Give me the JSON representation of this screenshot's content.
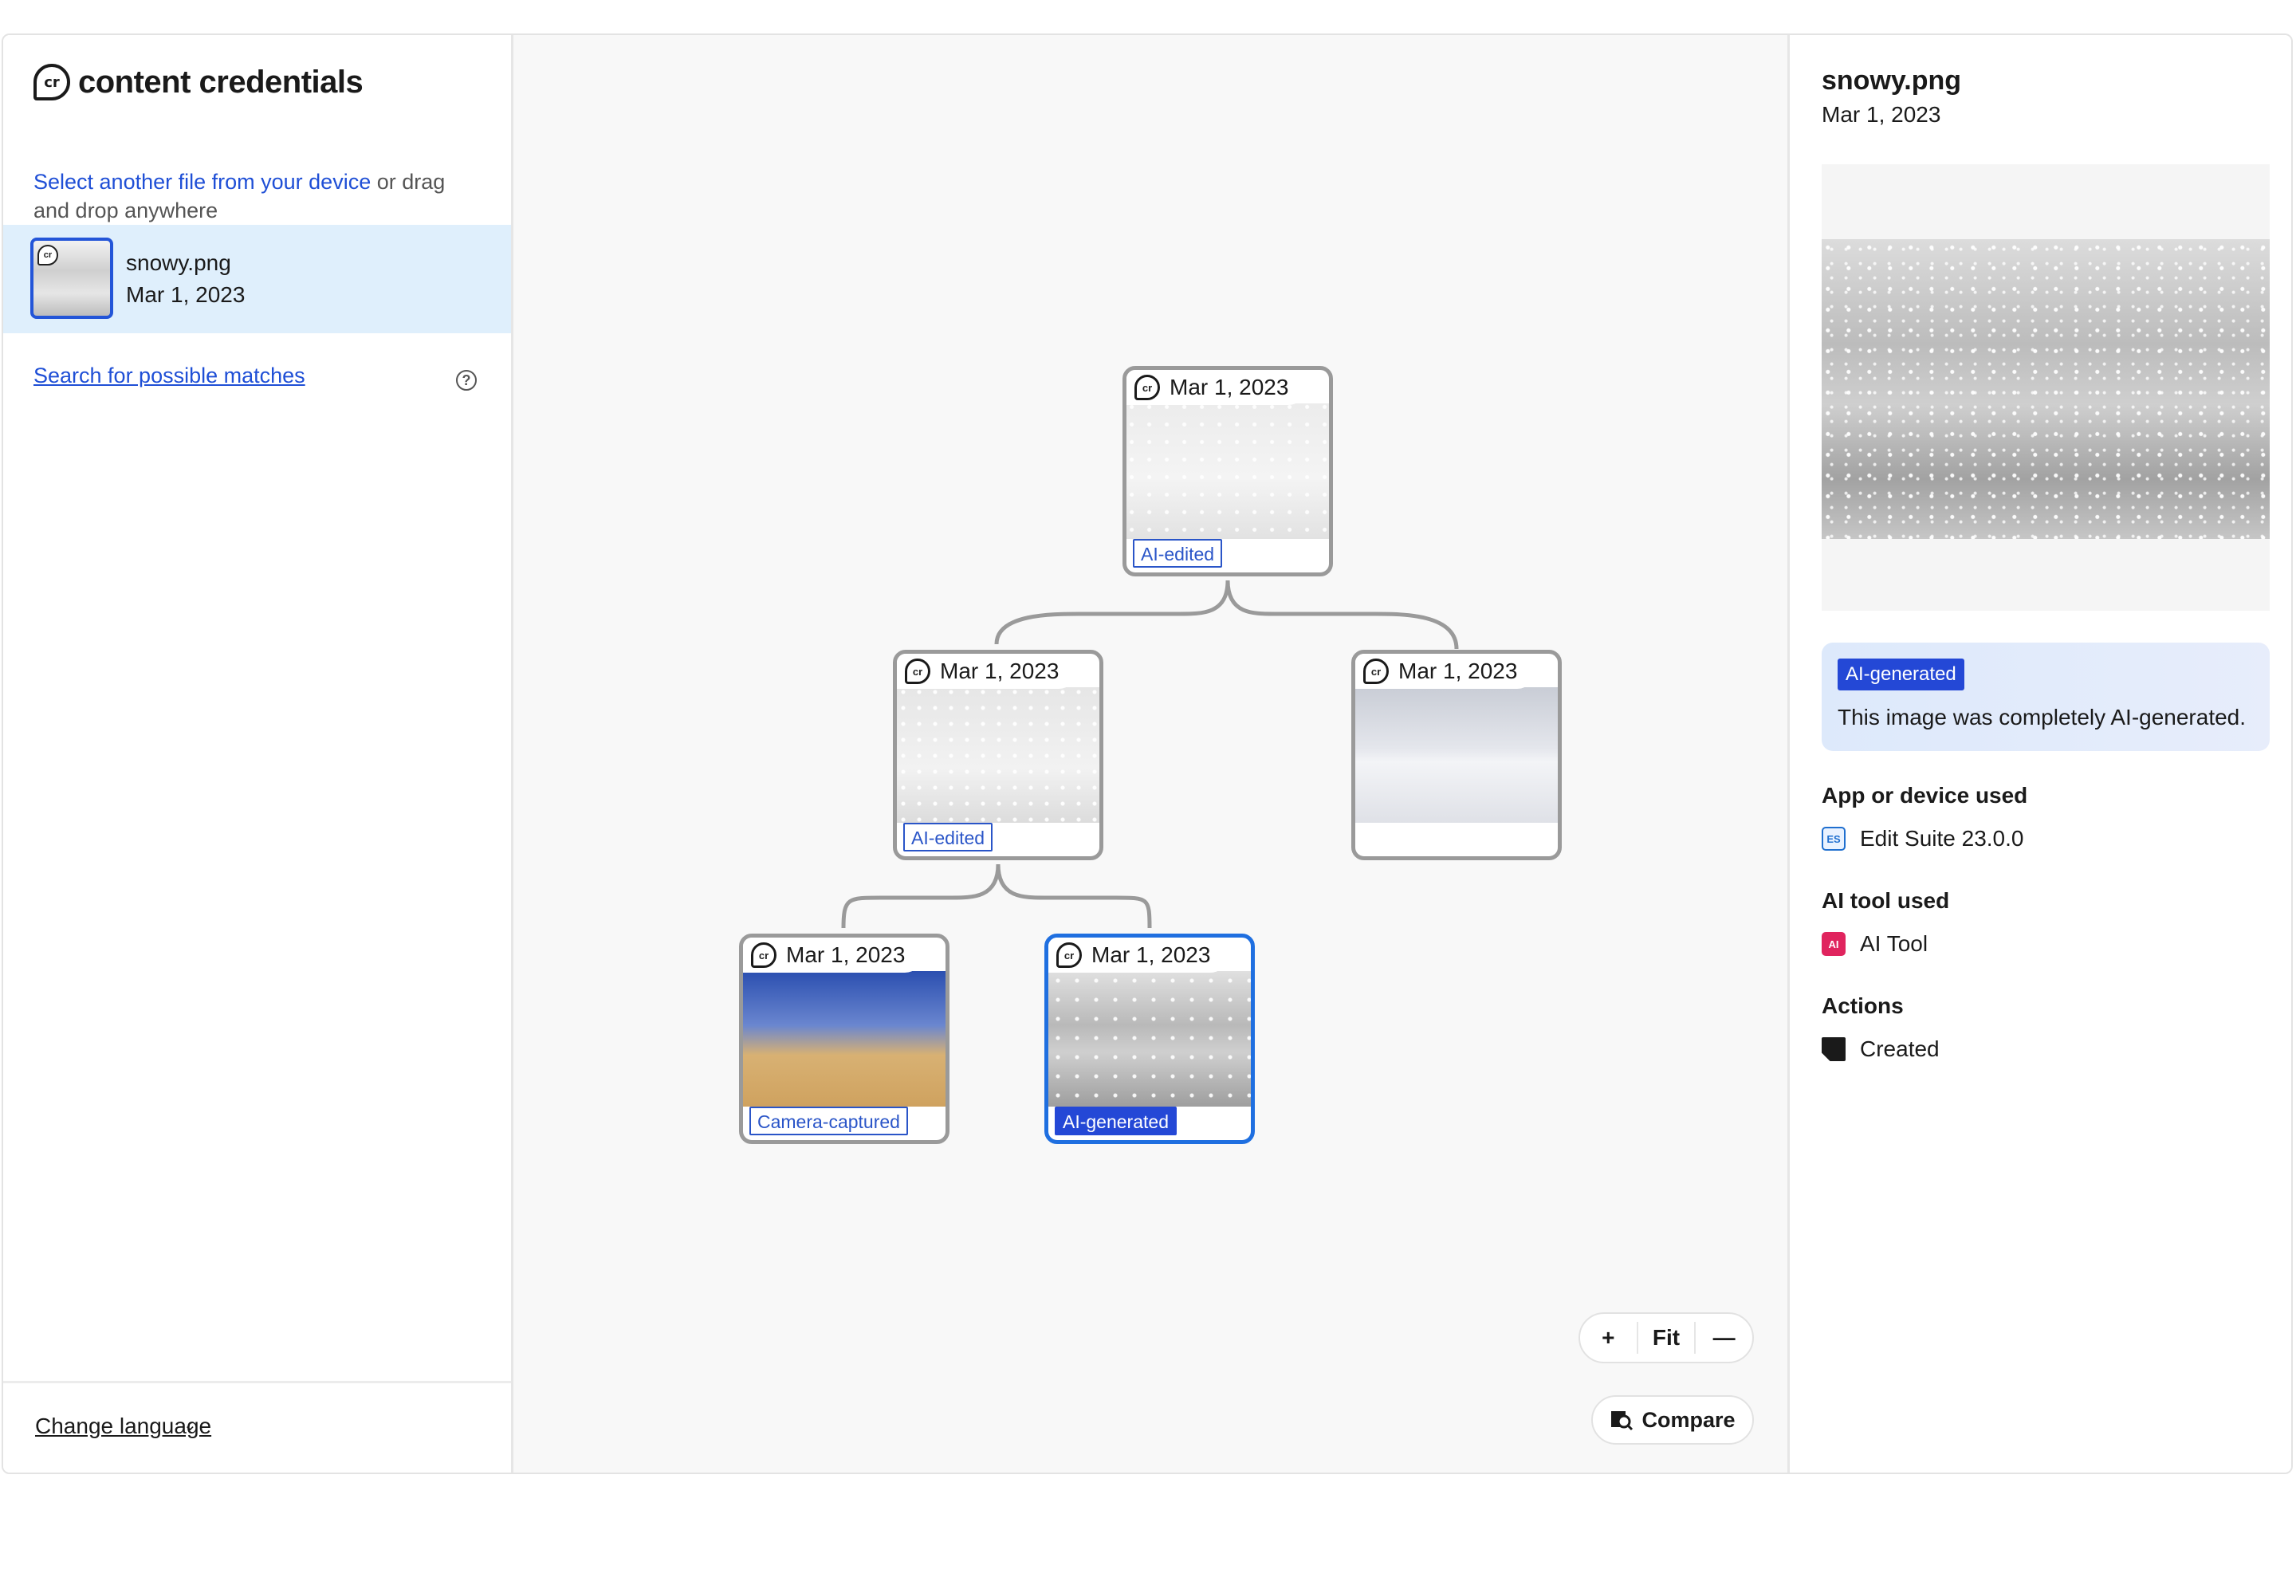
{
  "brand": {
    "logo": "cr",
    "name": "content credentials"
  },
  "select_file": {
    "link": "Select another file from your device",
    "rest": " or drag and drop anywhere"
  },
  "file": {
    "name": "snowy.png",
    "date": "Mar 1, 2023",
    "thumb_badge": "cr"
  },
  "search_link": "Search for possible matches",
  "help_icon": "?",
  "language": {
    "label": "Change language",
    "chevron": "⌄"
  },
  "tree": {
    "nodes": [
      {
        "id": "root",
        "date": "Mar 1, 2023",
        "badge": "AI-edited",
        "image": "snowy pyramids with polar bear"
      },
      {
        "id": "mid-left",
        "date": "Mar 1, 2023",
        "badge": "AI-edited",
        "image": "snowy pyramids"
      },
      {
        "id": "mid-right",
        "date": "Mar 1, 2023",
        "badge": "",
        "image": "polar bear on ice"
      },
      {
        "id": "leaf-left",
        "date": "Mar 1, 2023",
        "badge": "Camera-captured",
        "image": "desert pyramids"
      },
      {
        "id": "leaf-right",
        "date": "Mar 1, 2023",
        "badge": "AI-generated",
        "image": "snowy scene",
        "selected": true
      }
    ]
  },
  "zoom": {
    "in": "+",
    "fit": "Fit",
    "out": "—"
  },
  "compare": {
    "label": "Compare",
    "icon": "compare-magnifier-icon"
  },
  "panel": {
    "title": "snowy.png",
    "date": "Mar 1, 2023",
    "gen_badge": "AI-generated",
    "gen_text": "This image was completely AI-generated.",
    "app_title": "App or device used",
    "app_icon": "ES",
    "app_name": "Edit Suite 23.0.0",
    "ai_title": "AI tool used",
    "ai_icon": "AI",
    "ai_name": "AI Tool",
    "actions_title": "Actions",
    "action_created": "Created"
  },
  "colors": {
    "accent": "#1f4fd6",
    "selected_row": "#dfeffc",
    "badge_blue": "#2448d6",
    "selected_border": "#1f6fe0"
  }
}
